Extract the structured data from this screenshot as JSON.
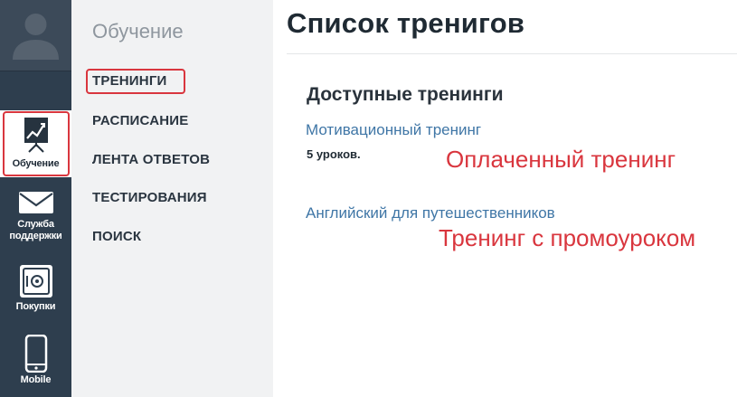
{
  "rail": {
    "items": [
      {
        "label": "Обучение"
      },
      {
        "label_line1": "Служба",
        "label_line2": "поддержки"
      },
      {
        "label": "Покупки"
      },
      {
        "label": "Mobile"
      }
    ]
  },
  "subnav": {
    "title": "Обучение",
    "items": [
      {
        "label": "ТРЕНИНГИ"
      },
      {
        "label": "РАСПИСАНИЕ"
      },
      {
        "label": "ЛЕНТА ОТВЕТОВ"
      },
      {
        "label": "ТЕСТИРОВАНИЯ"
      },
      {
        "label": "ПОИСК"
      }
    ]
  },
  "main": {
    "title": "Список тренигов",
    "section_title": "Доступные тренинги",
    "trainings": [
      {
        "title": "Мотивационный тренинг",
        "meta": "5 уроков."
      },
      {
        "title": "Английский для путешественников"
      }
    ]
  },
  "annotations": {
    "paid": "Оплаченный тренинг",
    "promo": "Тренинг с промоуроком"
  },
  "colors": {
    "rail_bg": "#2e3e4e",
    "subnav_bg": "#f1f2f3",
    "link": "#3f76a6",
    "annotation_red": "#d9363e"
  },
  "icons": [
    "user-avatar-icon",
    "chart-presentation-icon",
    "envelope-icon",
    "safe-icon",
    "mobile-phone-icon"
  ]
}
